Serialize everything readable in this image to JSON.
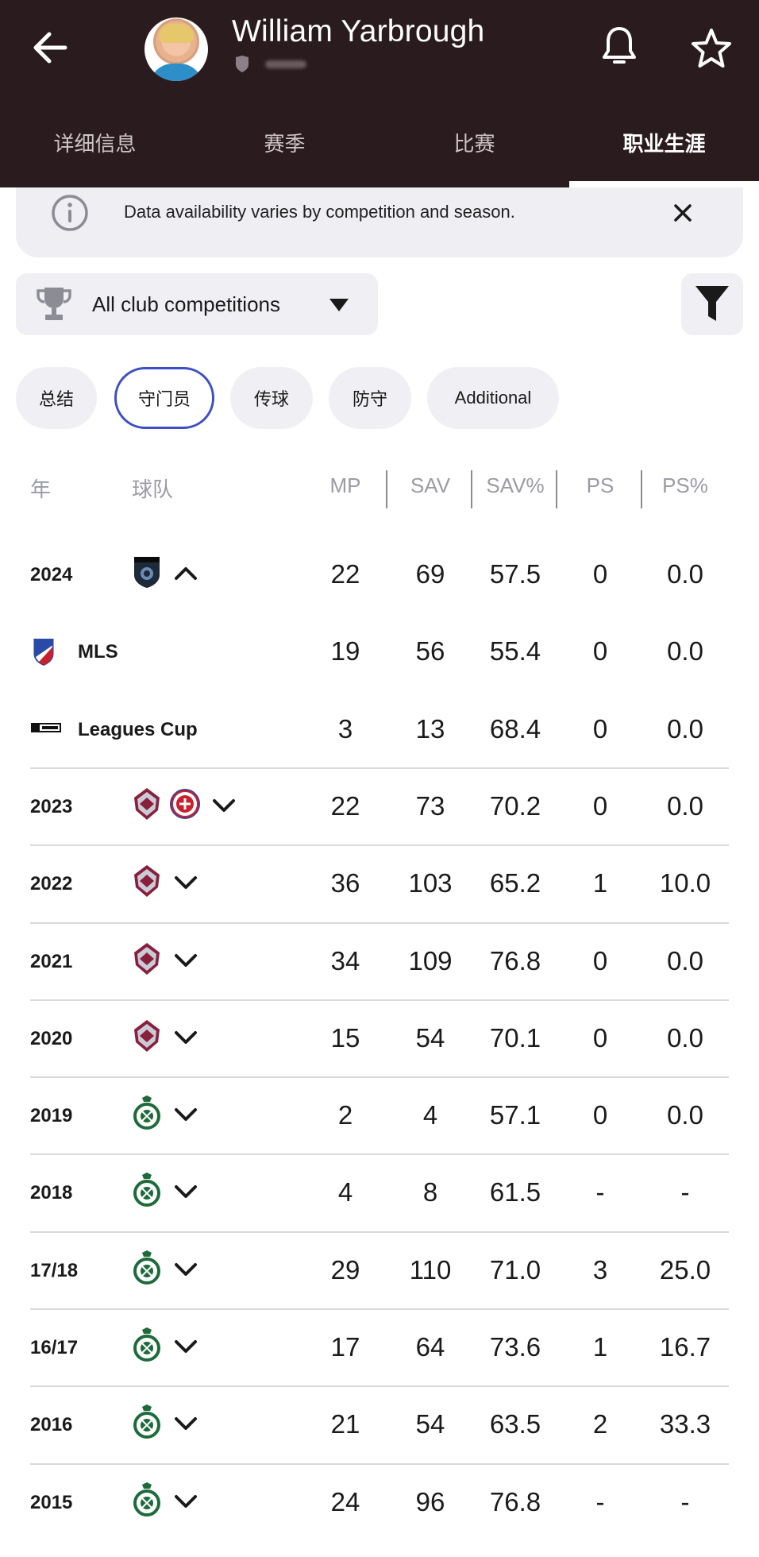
{
  "header": {
    "player_name": "William Yarbrough",
    "tabs": [
      {
        "label": "详细信息"
      },
      {
        "label": "赛季"
      },
      {
        "label": "比赛"
      },
      {
        "label": "职业生涯"
      }
    ],
    "active_tab": 3
  },
  "banner": {
    "message": "Data availability varies by competition and season."
  },
  "competition_select": {
    "value": "All club competitions"
  },
  "pills": [
    {
      "label": "总结"
    },
    {
      "label": "守门员"
    },
    {
      "label": "传球"
    },
    {
      "label": "防守"
    },
    {
      "label": "Additional"
    }
  ],
  "active_pill": 1,
  "table": {
    "headers": {
      "year": "年",
      "team": "球队",
      "mp": "MP",
      "sav": "SAV",
      "sav_pct": "SAV%",
      "ps": "PS",
      "ps_pct": "PS%"
    },
    "rows": [
      {
        "year": "2024",
        "mp": "22",
        "sav": "69",
        "sav_pct": "57.5",
        "ps": "0",
        "ps_pct": "0.0",
        "expanded": true
      },
      {
        "comp": "MLS",
        "mp": "19",
        "sav": "56",
        "sav_pct": "55.4",
        "ps": "0",
        "ps_pct": "0.0"
      },
      {
        "comp": "Leagues Cup",
        "mp": "3",
        "sav": "13",
        "sav_pct": "68.4",
        "ps": "0",
        "ps_pct": "0.0"
      },
      {
        "year": "2023",
        "mp": "22",
        "sav": "73",
        "sav_pct": "70.2",
        "ps": "0",
        "ps_pct": "0.0"
      },
      {
        "year": "2022",
        "mp": "36",
        "sav": "103",
        "sav_pct": "65.2",
        "ps": "1",
        "ps_pct": "10.0"
      },
      {
        "year": "2021",
        "mp": "34",
        "sav": "109",
        "sav_pct": "76.8",
        "ps": "0",
        "ps_pct": "0.0"
      },
      {
        "year": "2020",
        "mp": "15",
        "sav": "54",
        "sav_pct": "70.1",
        "ps": "0",
        "ps_pct": "0.0"
      },
      {
        "year": "2019",
        "mp": "2",
        "sav": "4",
        "sav_pct": "57.1",
        "ps": "0",
        "ps_pct": "0.0"
      },
      {
        "year": "2018",
        "mp": "4",
        "sav": "8",
        "sav_pct": "61.5",
        "ps": "-",
        "ps_pct": "-"
      },
      {
        "year": "17/18",
        "mp": "29",
        "sav": "110",
        "sav_pct": "71.0",
        "ps": "3",
        "ps_pct": "25.0"
      },
      {
        "year": "16/17",
        "mp": "17",
        "sav": "64",
        "sav_pct": "73.6",
        "ps": "1",
        "ps_pct": "16.7"
      },
      {
        "year": "2016",
        "mp": "21",
        "sav": "54",
        "sav_pct": "63.5",
        "ps": "2",
        "ps_pct": "33.3"
      },
      {
        "year": "2015",
        "mp": "24",
        "sav": "96",
        "sav_pct": "76.8",
        "ps": "-",
        "ps_pct": "-"
      }
    ]
  },
  "colors": {
    "header_bg": "#2a1b1e",
    "active_pill_border": "#3d4fc4",
    "surface": "#f0f0f4"
  },
  "icons": {
    "back": "arrow-left-icon",
    "bell": "bell-icon",
    "star": "star-icon",
    "info": "info-icon",
    "close": "close-icon",
    "trophy": "trophy-icon",
    "filter": "filter-icon"
  }
}
